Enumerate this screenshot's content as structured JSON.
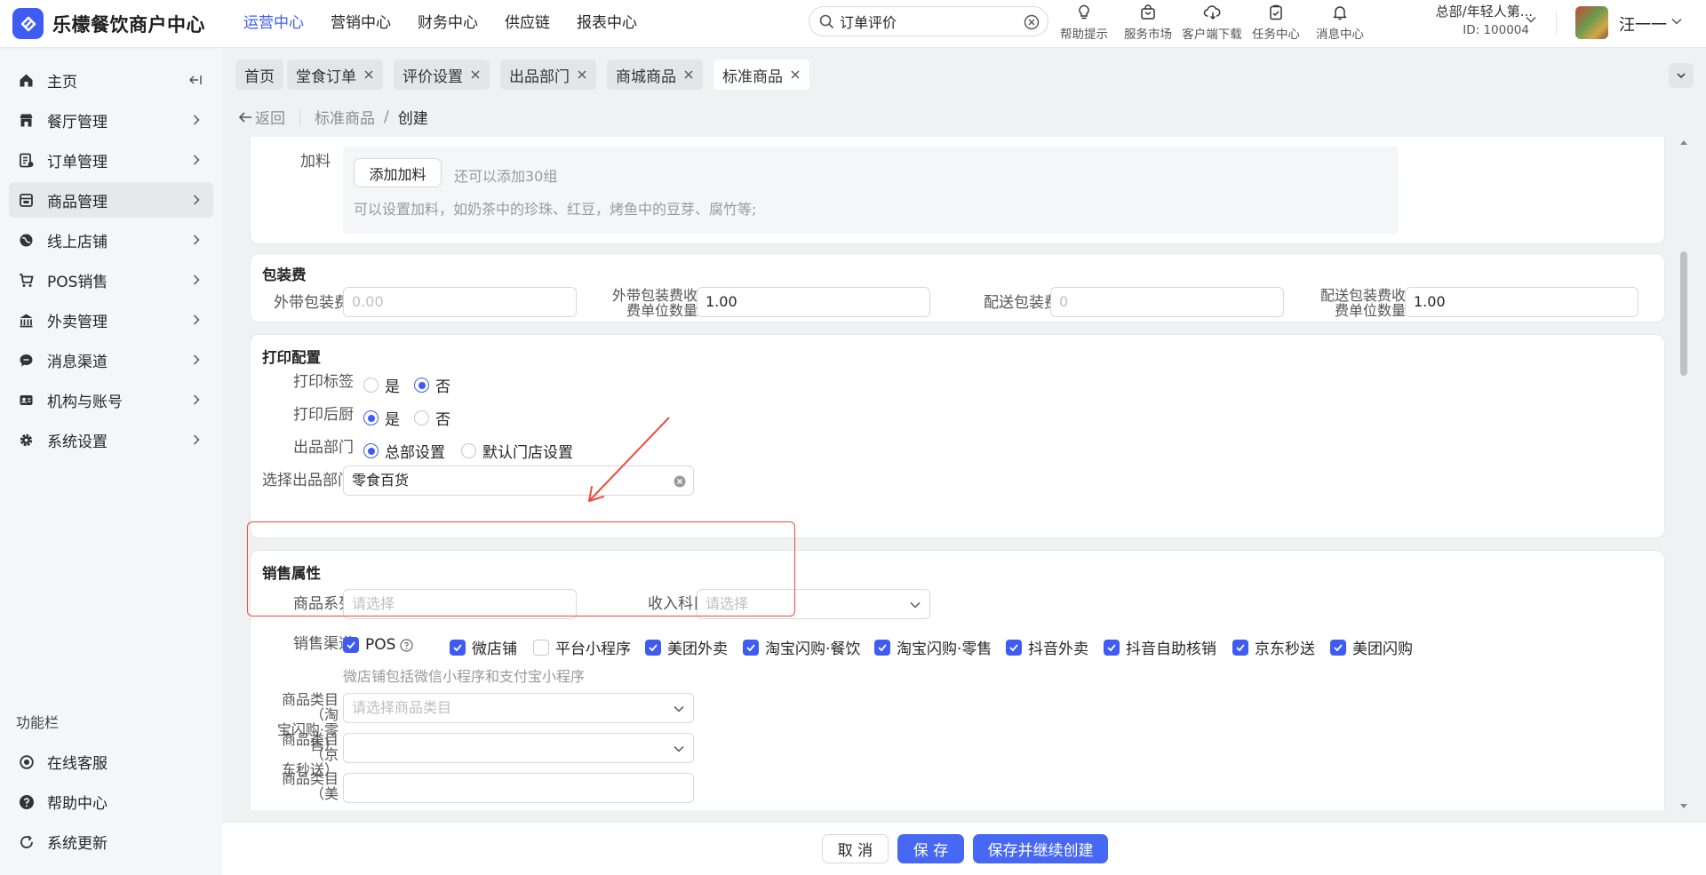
{
  "app": {
    "title": "乐檬餐饮商户中心"
  },
  "nav": {
    "items": [
      "运营中心",
      "营销中心",
      "财务中心",
      "供应链",
      "报表中心"
    ],
    "active_index": 0
  },
  "search": {
    "value": "订单评价"
  },
  "tools": [
    "帮助提示",
    "服务市场",
    "客户端下载",
    "任务中心",
    "消息中心"
  ],
  "account": {
    "org": "总部/年轻人第...",
    "id": "ID: 100004",
    "user": "汪一一"
  },
  "sidebar": {
    "items": [
      "主页",
      "餐厅管理",
      "订单管理",
      "商品管理",
      "线上店铺",
      "POS销售",
      "外卖管理",
      "消息渠道",
      "机构与账号",
      "系统设置"
    ],
    "active_index": 3,
    "func_title": "功能栏",
    "func_items": [
      "在线客服",
      "帮助中心",
      "系统更新"
    ]
  },
  "tabs": [
    "首页",
    "堂食订单",
    "评价设置",
    "出品部门",
    "商城商品",
    "标准商品"
  ],
  "active_tab": 5,
  "breadcrumb": {
    "back": "返回",
    "parent": "标准商品",
    "sep": "/",
    "current": "创建"
  },
  "addon": {
    "label": "加料",
    "button": "添加加料",
    "hint": "还可以添加30组",
    "desc": "可以设置加料，如奶茶中的珍珠、红豆，烤鱼中的豆芽、腐竹等;"
  },
  "packing": {
    "title": "包装费",
    "takeaway_fee": {
      "label": "外带包装费",
      "placeholder": "0.00"
    },
    "takeaway_unit": {
      "label_line1": "外带包装费收",
      "label_line2": "费单位数量",
      "value": "1.00"
    },
    "delivery_fee": {
      "label": "配送包装费",
      "placeholder": "0"
    },
    "delivery_unit": {
      "label_line1": "配送包装费收",
      "label_line2": "费单位数量",
      "value": "1.00"
    }
  },
  "print": {
    "title": "打印配置",
    "label_print": {
      "label": "打印标签",
      "options": [
        "是",
        "否"
      ],
      "selected": 1
    },
    "kitchen_print": {
      "label": "打印后厨",
      "options": [
        "是",
        "否"
      ],
      "selected": 0
    },
    "dept": {
      "label": "出品部门",
      "options": [
        "总部设置",
        "默认门店设置"
      ],
      "selected": 0
    },
    "select_dept": {
      "label": "选择出品部门",
      "value": "零食百货"
    }
  },
  "sales": {
    "title": "销售属性",
    "series": {
      "label": "商品系列",
      "placeholder": "请选择"
    },
    "income": {
      "label": "收入科目",
      "placeholder": "请选择"
    },
    "channels": {
      "label": "销售渠道",
      "items": [
        {
          "label": "POS",
          "checked": true
        },
        {
          "label": "微店铺",
          "checked": true
        },
        {
          "label": "平台小程序",
          "checked": false
        },
        {
          "label": "美团外卖",
          "checked": true
        },
        {
          "label": "淘宝闪购·餐饮",
          "checked": true
        },
        {
          "label": "淘宝闪购·零售",
          "checked": true
        },
        {
          "label": "抖音外卖",
          "checked": true
        },
        {
          "label": "抖音自助核销",
          "checked": true
        },
        {
          "label": "京东秒送",
          "checked": true
        },
        {
          "label": "美团闪购",
          "checked": true
        }
      ],
      "hint": "微店铺包括微信小程序和支付宝小程序"
    },
    "cat_taobao": {
      "label_line1": "商品类目（淘",
      "label_line2": "宝闪购·零售）",
      "placeholder": "请选择商品类目"
    },
    "cat_jd": {
      "label_line1": "商品类目（京",
      "label_line2": "东秒送）"
    },
    "cat_next": {
      "label_line1": "商品类目（美"
    }
  },
  "footer": {
    "cancel": "取 消",
    "save": "保 存",
    "save_continue": "保存并继续创建"
  },
  "colors": {
    "primary": "#3f5cf2",
    "annotation": "#f04a3d"
  }
}
